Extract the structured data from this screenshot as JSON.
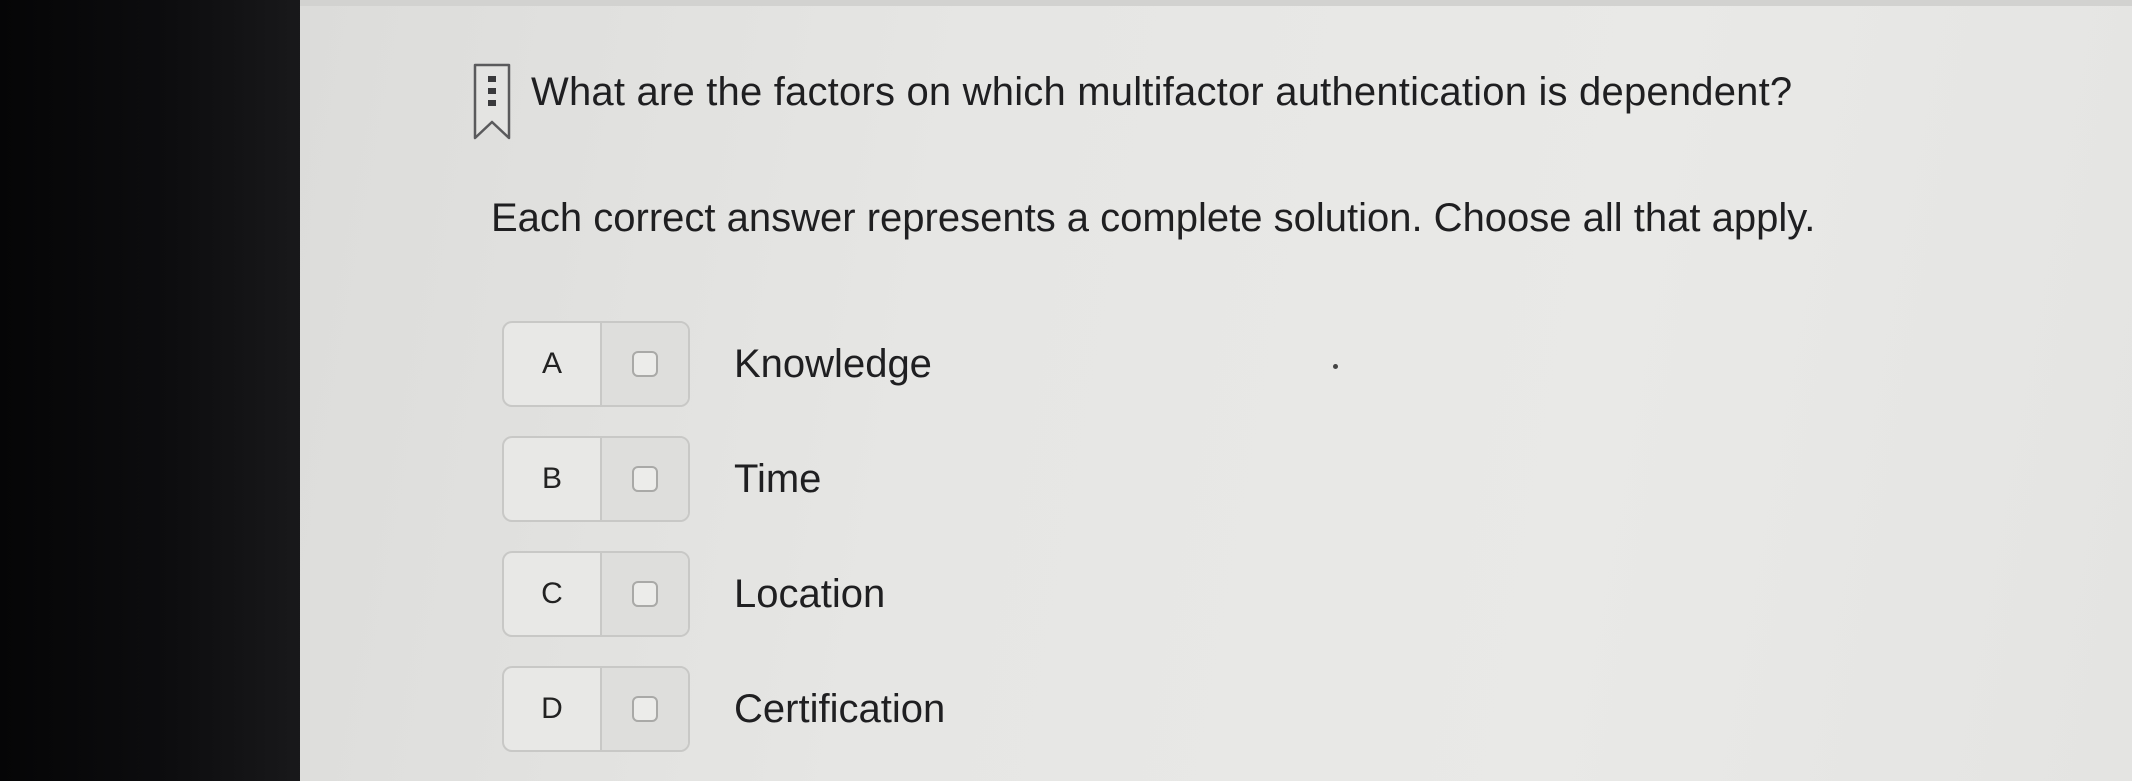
{
  "question": {
    "text": "What are the factors on which multifactor authentication is dependent?",
    "bookmark_icon": "bookmark-icon"
  },
  "instructions": "Each correct answer represents a complete solution. Choose all that apply.",
  "options": [
    {
      "letter": "A",
      "label": "Knowledge",
      "checked": false
    },
    {
      "letter": "B",
      "label": "Time",
      "checked": false
    },
    {
      "letter": "C",
      "label": "Location",
      "checked": false
    },
    {
      "letter": "D",
      "label": "Certification",
      "checked": false
    }
  ],
  "colors": {
    "background": "#e6e6e4",
    "text": "#1f1f21",
    "border": "#c8c8c6"
  }
}
